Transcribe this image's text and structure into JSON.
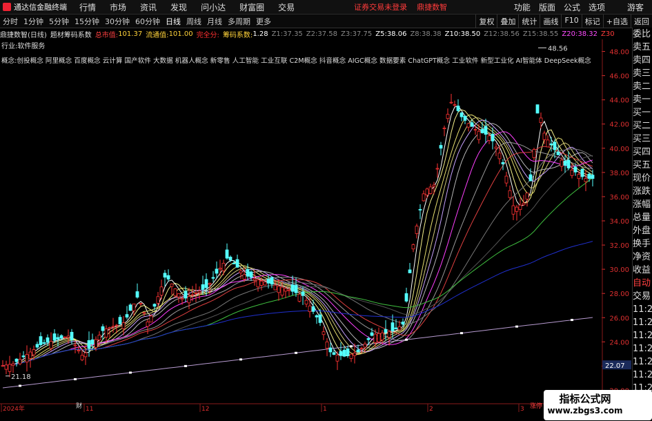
{
  "app": {
    "title": "通达信金融终端",
    "menu": [
      "行情",
      "市场",
      "资讯",
      "发现",
      "问小达",
      "财富圈",
      "交易"
    ],
    "warning": "证券交易未登录",
    "broker": "鼎捷数智",
    "right_menu": [
      "功能",
      "版面",
      "公式",
      "选项"
    ],
    "guest": "游客"
  },
  "toolbar": {
    "periods": [
      "分时",
      "1分钟",
      "5分钟",
      "15分钟",
      "30分钟",
      "60分钟",
      "日线",
      "周线",
      "月线",
      "多周期",
      "更多"
    ],
    "active_period": "日线",
    "buttons": [
      "复权",
      "叠加",
      "统计",
      "画线",
      "F10",
      "标记",
      "+自选",
      "返回"
    ]
  },
  "info": {
    "stock": "鼎捷数智(日线)",
    "indicator": "题材筹码系数",
    "total_cap_label": "总市值:",
    "total_cap": "101.37",
    "float_cap_label": "流通值:",
    "float_cap": "101.00",
    "full_score": "完全分:",
    "chip_label": "筹码系数:",
    "chip_value": "1.28",
    "z_items": [
      {
        "label": "Z1:",
        "value": "37.35"
      },
      {
        "label": "Z2:",
        "value": "37.58"
      },
      {
        "label": "Z3:",
        "value": "37.75"
      },
      {
        "label": "Z5:",
        "value": "38.06"
      },
      {
        "label": "Z8:",
        "value": "38.38"
      },
      {
        "label": "Z10:",
        "value": "38.50"
      },
      {
        "label": "Z12:",
        "value": "38.56"
      },
      {
        "label": "Z15:",
        "value": "38.55"
      },
      {
        "label": "Z20:",
        "value": "38.32"
      },
      {
        "label": "Z30",
        "value": ""
      }
    ],
    "industry": "行业:软件服务",
    "concepts": "概念:创投概念 阿里概念 百度概念 云计算 国产软件 大数据 机器人概念 新零售 人工智能 工业互联 C2M概念 抖音概念 AIGC概念 数据要素 ChatGPT概念 工业软件 新型工业化 AI智能体 DeepSeek概念"
  },
  "chart_data": {
    "type": "candlestick",
    "price_axis": [
      "48.00",
      "46.00",
      "44.00",
      "42.00",
      "40.00",
      "38.00",
      "36.00",
      "34.00",
      "32.00",
      "30.00",
      "28.00",
      "26.00",
      "24.00",
      "22.00",
      "20.00"
    ],
    "ylim": [
      19,
      49
    ],
    "time_axis": [
      "2024年",
      "11",
      "12",
      "1",
      "2",
      "3"
    ],
    "high_label": "48.56",
    "low_label": "21.18",
    "current_price": "22.07",
    "bottom_tag": "财",
    "bottom_tag2": "涨停"
  },
  "right_panel": [
    "委比",
    "卖五",
    "卖四",
    "卖三",
    "卖二",
    "卖一",
    "买一",
    "买二",
    "买三",
    "买四",
    "买五",
    "现价",
    "涨跌",
    "涨幅",
    "总量",
    "外盘",
    "换手",
    "净资",
    "收益",
    "自动",
    "交易",
    "11:29",
    "11:29",
    "11:29",
    "11:29",
    "11:29",
    "11:29",
    "11:29",
    "11:29",
    "11:29"
  ],
  "watermark": {
    "title": "指标公式网",
    "url": "www.zbgs3.com"
  }
}
